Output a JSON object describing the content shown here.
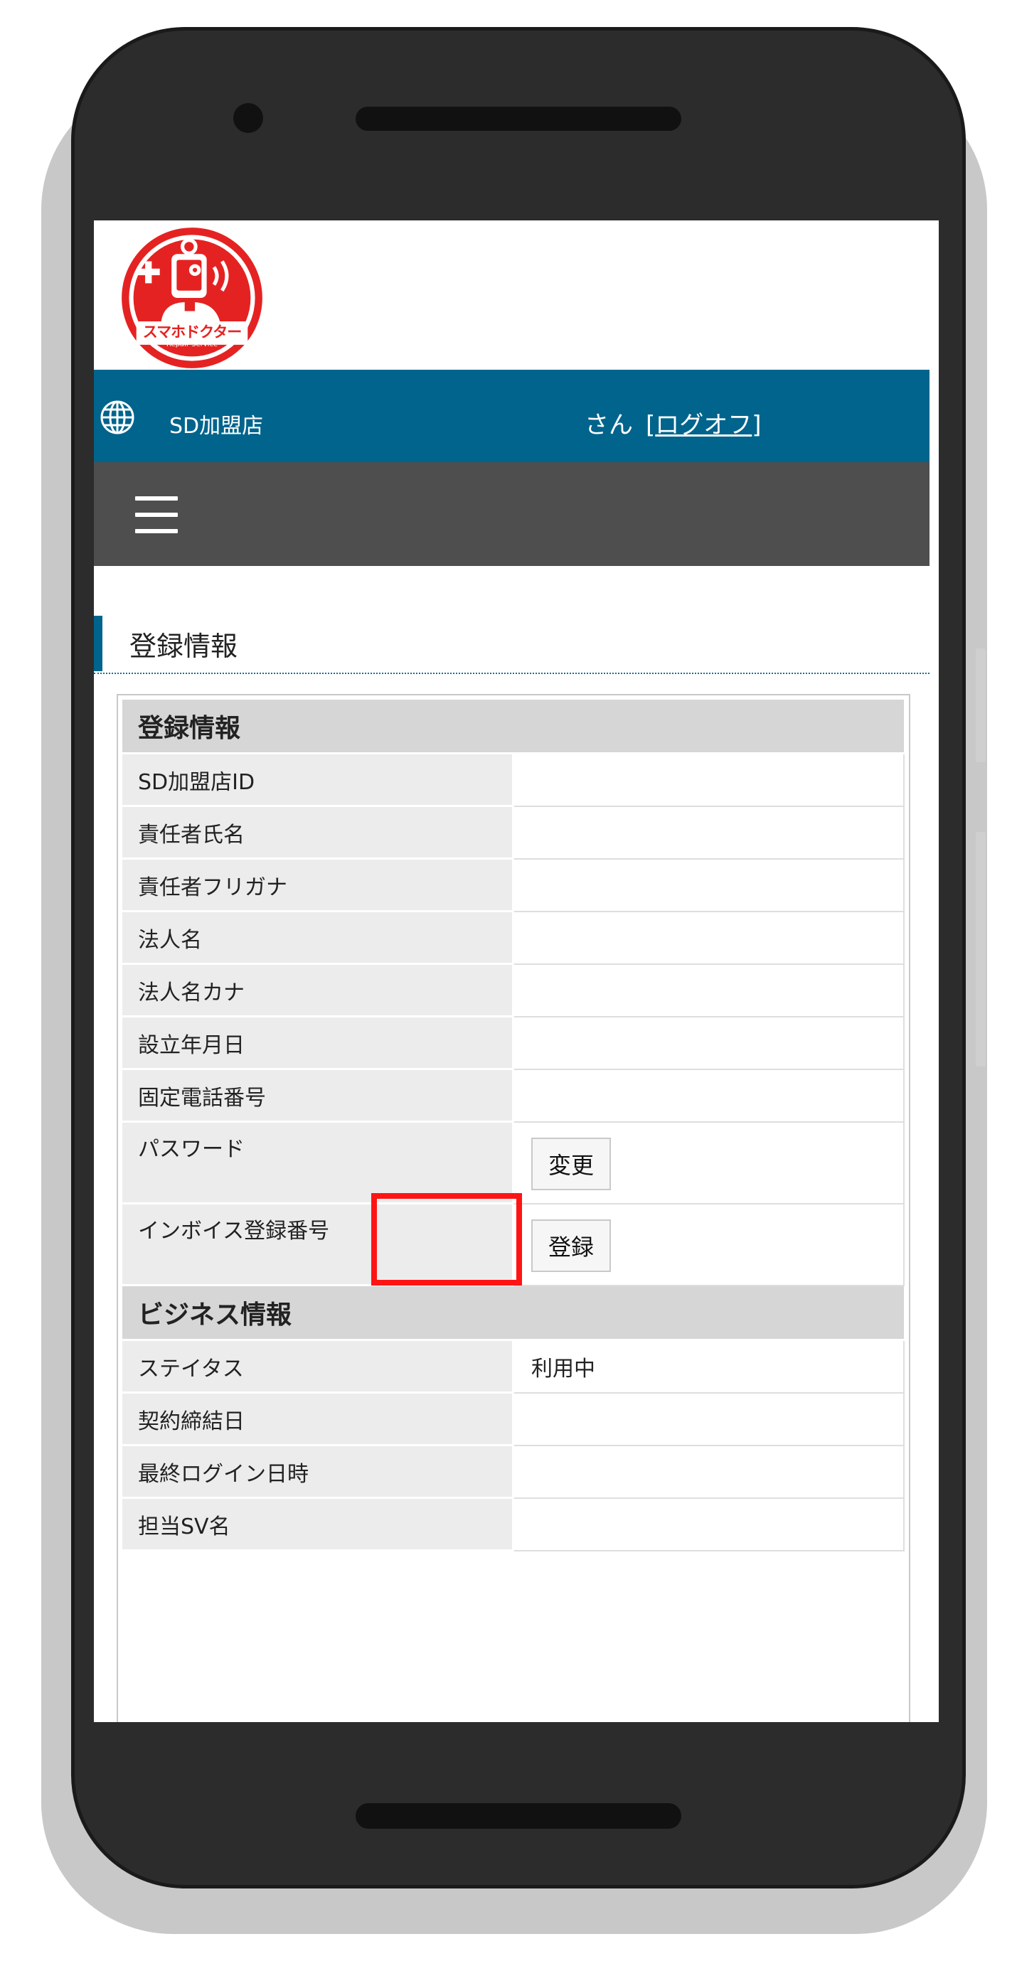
{
  "header": {
    "logo_text": "スマホドクター",
    "logo_sub": "Repair Service",
    "store_name": "SD加盟店",
    "user_suffix": "さん",
    "logoff_prefix": "[",
    "logoff_label": "ログオフ",
    "logoff_suffix": "]"
  },
  "page": {
    "title": "登録情報"
  },
  "sections": {
    "registration": {
      "heading": "登録情報",
      "rows": [
        {
          "label": "SD加盟店ID",
          "value": ""
        },
        {
          "label": "責任者氏名",
          "value": ""
        },
        {
          "label": "責任者フリガナ",
          "value": ""
        },
        {
          "label": "法人名",
          "value": ""
        },
        {
          "label": "法人名カナ",
          "value": ""
        },
        {
          "label": "設立年月日",
          "value": ""
        },
        {
          "label": "固定電話番号",
          "value": ""
        }
      ],
      "password_label": "パスワード",
      "password_button": "変更",
      "invoice_label": "インボイス登録番号",
      "invoice_button": "登録"
    },
    "business": {
      "heading": "ビジネス情報",
      "rows": [
        {
          "label": "ステイタス",
          "value": "利用中"
        },
        {
          "label": "契約締結日",
          "value": ""
        },
        {
          "label": "最終ログイン日時",
          "value": ""
        },
        {
          "label": "担当SV名",
          "value": ""
        }
      ]
    }
  },
  "colors": {
    "userbar": "#00648c",
    "menubar": "#4e4e4e",
    "highlight": "#ff1414",
    "logo_red": "#e52222"
  },
  "icons": [
    "globe-icon",
    "hamburger-menu-icon",
    "logo-doctor-icon"
  ]
}
